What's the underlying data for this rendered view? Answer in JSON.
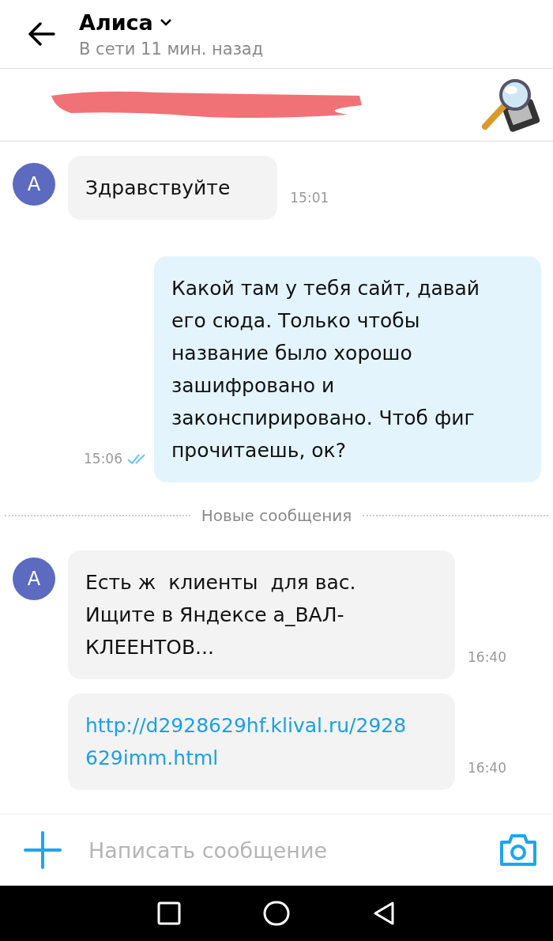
{
  "header": {
    "title": "Алиса",
    "status": "В сети 11 мин. назад"
  },
  "pinned": {
    "redacted": true
  },
  "messages": [
    {
      "kind": "incoming",
      "avatar": "А",
      "text": "Здравствуйте",
      "time": "15:01"
    },
    {
      "kind": "outgoing",
      "text": "Какой там у тебя сайт, давай его сюда. Только чтобы название было хорошо зашифровано и законспирировано. Чтоб фиг прочитаешь, ок?",
      "time": "15:06",
      "read": true
    },
    {
      "kind": "divider",
      "text": "Новые сообщения"
    },
    {
      "kind": "incoming",
      "avatar": "А",
      "text": "Есть ж  клиенты  для вас. Ищите в Яндексе а_ВАЛ-КЛЕЕНТОВ...",
      "time": "16:40"
    },
    {
      "kind": "link",
      "text": "http://d2928629hf.klival.ru/2928629imm.html",
      "time": "16:40"
    }
  ],
  "composer": {
    "placeholder": "Написать сообщение"
  }
}
